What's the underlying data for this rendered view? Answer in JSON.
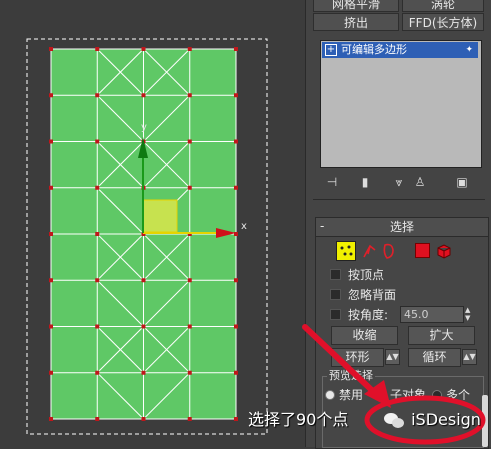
{
  "viewport": {
    "axis_x_label": "x",
    "axis_y_label": "y"
  },
  "panel": {
    "top_buttons": [
      "网格平滑",
      "涡轮"
    ],
    "extrude_label": "挤出",
    "ffd_label": "FFD(长方体)",
    "stack_item_label": "可编辑多边形",
    "stack_item_expand": "+"
  },
  "selection": {
    "collapse_glyph": "-",
    "title": "选择",
    "by_vertex": "按顶点",
    "ignore_backfacing": "忽略背面",
    "by_angle": "按角度:",
    "angle_value": "45.0",
    "shrink_label": "收缩",
    "grow_label": "扩大",
    "ring_label": "环形",
    "loop_label": "循环",
    "preview_title": "预览选择",
    "preview_options": [
      "禁用",
      "子对象",
      "多个"
    ],
    "status_text": "选择了90个点"
  },
  "watermark": {
    "text": "iSDesign"
  },
  "colors": {
    "mesh_fill": "#5fc866",
    "vertex": "#c0171b",
    "selection_fill": "#c7e24f",
    "axis_x": "#e6d400",
    "axis_y": "#1a7a1a",
    "annotation": "#e0102a",
    "stack_highlight": "#2e5fb5",
    "active_mode": "#f0f000"
  }
}
